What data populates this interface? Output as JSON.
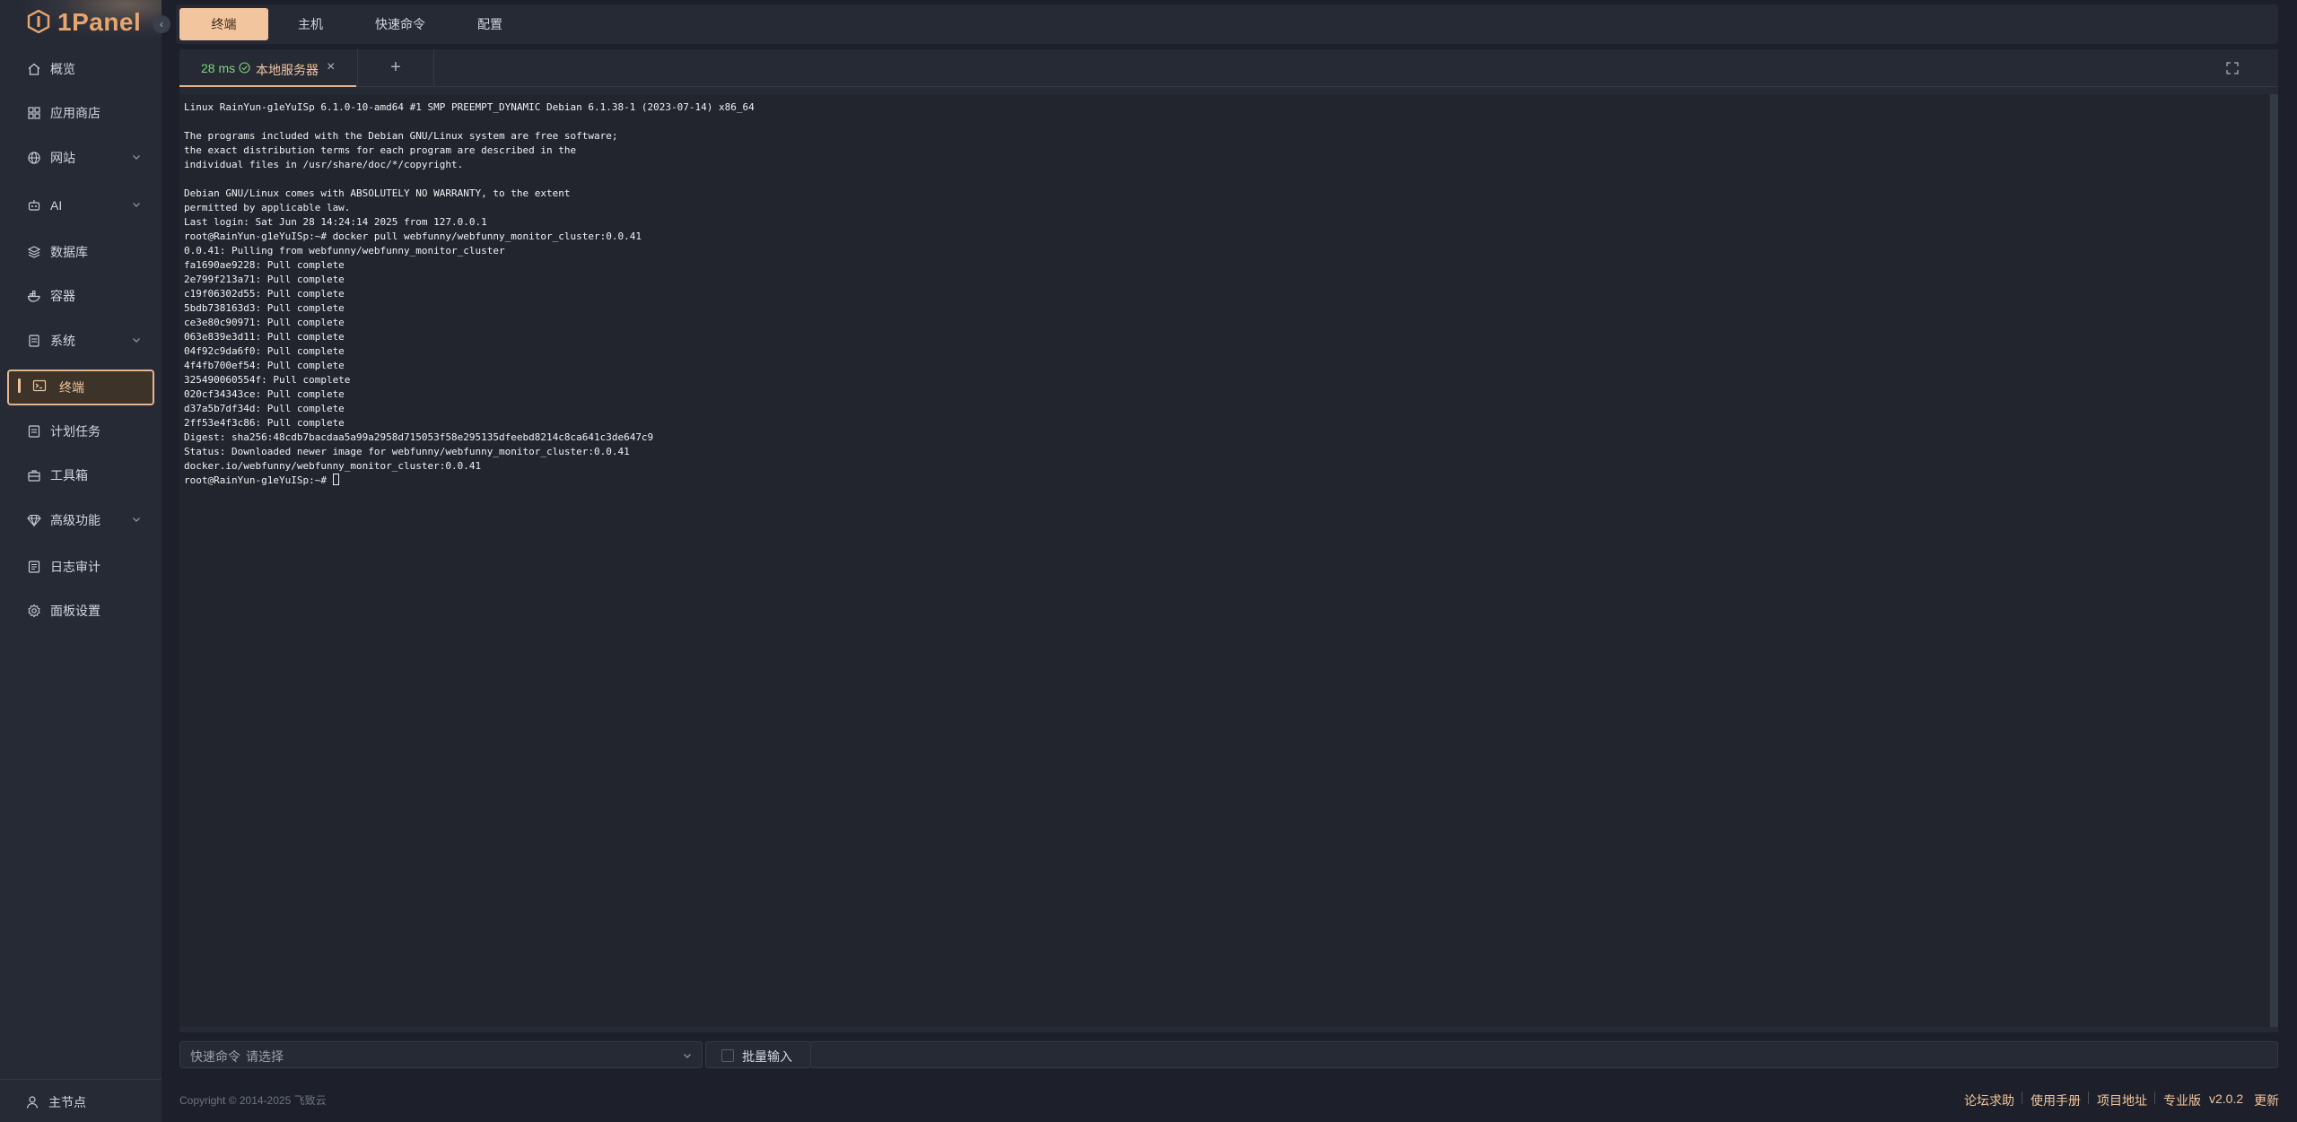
{
  "app": {
    "logo_text": "1Panel"
  },
  "sidebar": {
    "items": [
      {
        "label": "概览"
      },
      {
        "label": "应用商店"
      },
      {
        "label": "网站"
      },
      {
        "label": "AI"
      },
      {
        "label": "数据库"
      },
      {
        "label": "容器"
      },
      {
        "label": "系统"
      },
      {
        "label": "终端"
      },
      {
        "label": "计划任务"
      },
      {
        "label": "工具箱"
      },
      {
        "label": "高级功能"
      },
      {
        "label": "日志审计"
      },
      {
        "label": "面板设置"
      }
    ],
    "node_label": "主节点"
  },
  "top_tabs": [
    "终端",
    "主机",
    "快速命令",
    "配置"
  ],
  "terminal_tab": {
    "latency": "28 ms",
    "host": "本地服务器",
    "close": "×",
    "add": "+"
  },
  "terminal": {
    "lines": [
      "Linux RainYun-g1eYuISp 6.1.0-10-amd64 #1 SMP PREEMPT_DYNAMIC Debian 6.1.38-1 (2023-07-14) x86_64",
      "",
      "The programs included with the Debian GNU/Linux system are free software;",
      "the exact distribution terms for each program are described in the",
      "individual files in /usr/share/doc/*/copyright.",
      "",
      "Debian GNU/Linux comes with ABSOLUTELY NO WARRANTY, to the extent",
      "permitted by applicable law.",
      "Last login: Sat Jun 28 14:24:14 2025 from 127.0.0.1",
      "root@RainYun-g1eYuISp:~# docker pull webfunny/webfunny_monitor_cluster:0.0.41",
      "0.0.41: Pulling from webfunny/webfunny_monitor_cluster",
      "fa1690ae9228: Pull complete",
      "2e799f213a71: Pull complete",
      "c19f06302d55: Pull complete",
      "5bdb738163d3: Pull complete",
      "ce3e80c90971: Pull complete",
      "063e839e3d11: Pull complete",
      "04f92c9da6f0: Pull complete",
      "4f4fb700ef54: Pull complete",
      "325490060554f: Pull complete",
      "020cf34343ce: Pull complete",
      "d37a5b7df34d: Pull complete",
      "2ff53e4f3c86: Pull complete",
      "Digest: sha256:48cdb7bacdaa5a99a2958d715053f58e295135dfeebd8214c8ca641c3de647c9",
      "Status: Downloaded newer image for webfunny/webfunny_monitor_cluster:0.0.41",
      "docker.io/webfunny/webfunny_monitor_cluster:0.0.41"
    ],
    "prompt": "root@RainYun-g1eYuISp:~# "
  },
  "command_bar": {
    "quick_label": "快速命令",
    "quick_placeholder": "请选择",
    "batch_label": "批量输入",
    "input_value": ""
  },
  "footer": {
    "copyright": "Copyright © 2014-2025 飞致云",
    "links": [
      "论坛求助",
      "使用手册",
      "项目地址",
      "专业版",
      "v2.0.2",
      "更新"
    ]
  },
  "colors": {
    "accent": "#f2c59e",
    "accent_border": "#e6b48d",
    "latency_green": "#7fd47a",
    "bg": "#1d202a",
    "panel": "#262a35"
  }
}
